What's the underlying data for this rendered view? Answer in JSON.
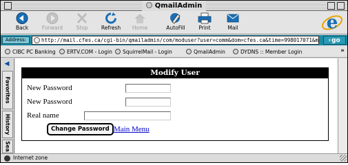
{
  "window": {
    "title": "QmailAdmin"
  },
  "toolbar": {
    "back": "Back",
    "forward": "Forward",
    "stop": "Stop",
    "refresh": "Refresh",
    "home": "Home",
    "autofill": "AutoFill",
    "print": "Print",
    "mail": "Mail"
  },
  "address": {
    "label": "Address:",
    "url": "http://mail.cfes.ca/cgi-bin/qmailadmin/com/moduser?user=comm&dom=cfes.ca&time=998017071&moduser=comm",
    "go": "go"
  },
  "favorites": [
    {
      "label": "CIBC PC Banking"
    },
    {
      "label": "ERTV.COM - Login"
    },
    {
      "label": "SquirrelMail - Login"
    },
    {
      "label": "QmailAdmin"
    },
    {
      "label": "DYDNS :: Member Login"
    }
  ],
  "sidebar": {
    "tabs": [
      "Favorites",
      "History",
      "Sea"
    ]
  },
  "form": {
    "heading": "Modify User",
    "new_password_label": "New Password",
    "confirm_password_label": "New Password",
    "real_name_label": "Real name",
    "new_password_value": "",
    "confirm_password_value": "",
    "real_name_value": "",
    "submit": "Change Password",
    "main_menu": "Main Menu"
  },
  "status": {
    "zone": "Internet zone"
  },
  "colors": {
    "address_bar": "#1e8ba4",
    "link": "#0000cc",
    "heading_bg": "#000000"
  }
}
